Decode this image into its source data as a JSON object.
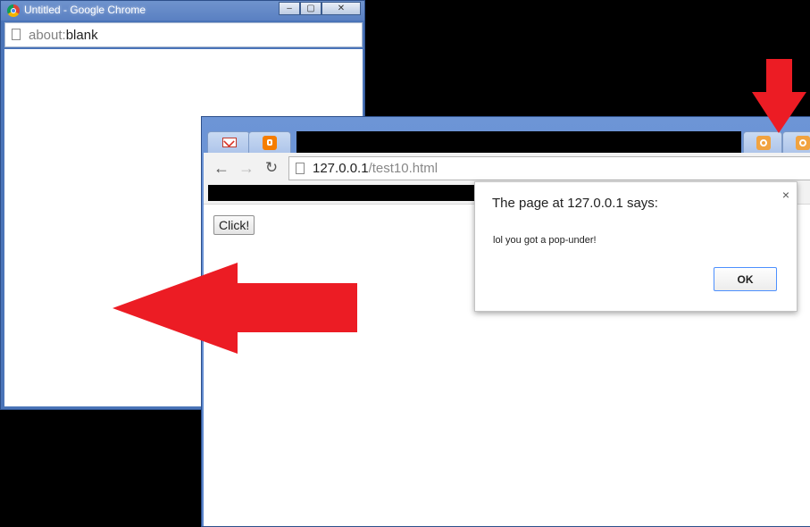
{
  "back_window": {
    "title": "Untitled - Google Chrome",
    "url_prefix": "about:",
    "url_host": "blank",
    "controls": {
      "minimize": "–",
      "maximize": "▢",
      "close": "✕"
    }
  },
  "front_window": {
    "url_host": "127.0.0.1",
    "url_path": "/test10.html",
    "nav": {
      "back": "←",
      "forward": "→",
      "reload": "↻"
    },
    "tabs": [
      {
        "icon": "gmail-icon"
      },
      {
        "icon": "blogger-icon"
      },
      {
        "icon": "extension-icon"
      },
      {
        "icon": "extension-icon"
      }
    ],
    "page": {
      "button_label": "Click!"
    }
  },
  "dialog": {
    "title": "The page at 127.0.0.1 says:",
    "message": "lol you got a pop-under!",
    "ok_label": "OK",
    "close_glyph": "×"
  },
  "colors": {
    "arrow": "#ec1c24",
    "ok_border": "#4d90fe"
  }
}
